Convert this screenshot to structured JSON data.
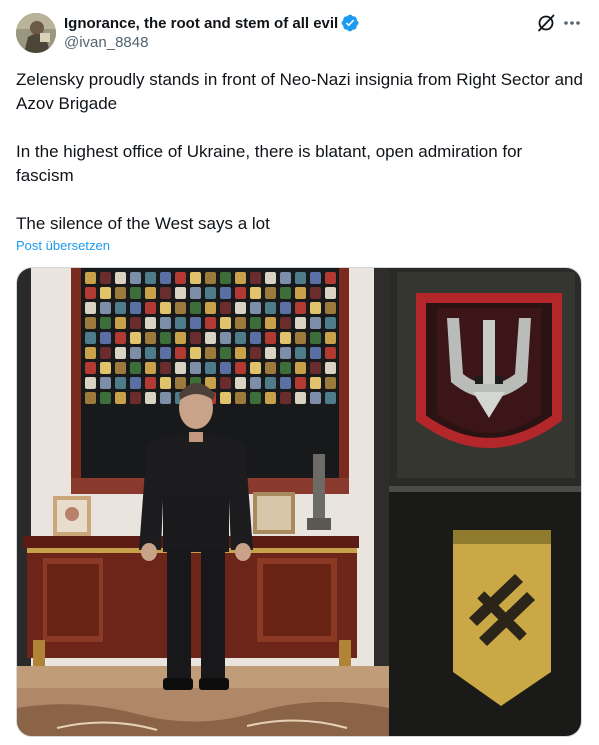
{
  "author": {
    "display_name": "Ignorance, the root and stem of all evil",
    "handle": "@ivan_8848",
    "verified": true,
    "avatar_icon": "avatar-painting"
  },
  "actions": {
    "grok_icon": "grok-icon",
    "more_icon": "more-icon"
  },
  "post": {
    "paragraphs": [
      "Zelensky proudly stands in front of Neo-Nazi insignia from Right Sector and Azov Brigade",
      "In the highest office of Ukraine, there is blatant, open admiration for fascism",
      "The silence of the West says a lot"
    ],
    "translate_label": "Post übersetzen"
  },
  "media": {
    "main_photo_icon": "photo-man-in-office-with-patch-wall",
    "zoom_top_icon": "trident-patch-zoom",
    "zoom_bottom_icon": "yellow-shield-patch-zoom"
  },
  "colors": {
    "link": "#1d9bf0",
    "verified": "#1d9bf0",
    "secondary_text": "#536471"
  }
}
